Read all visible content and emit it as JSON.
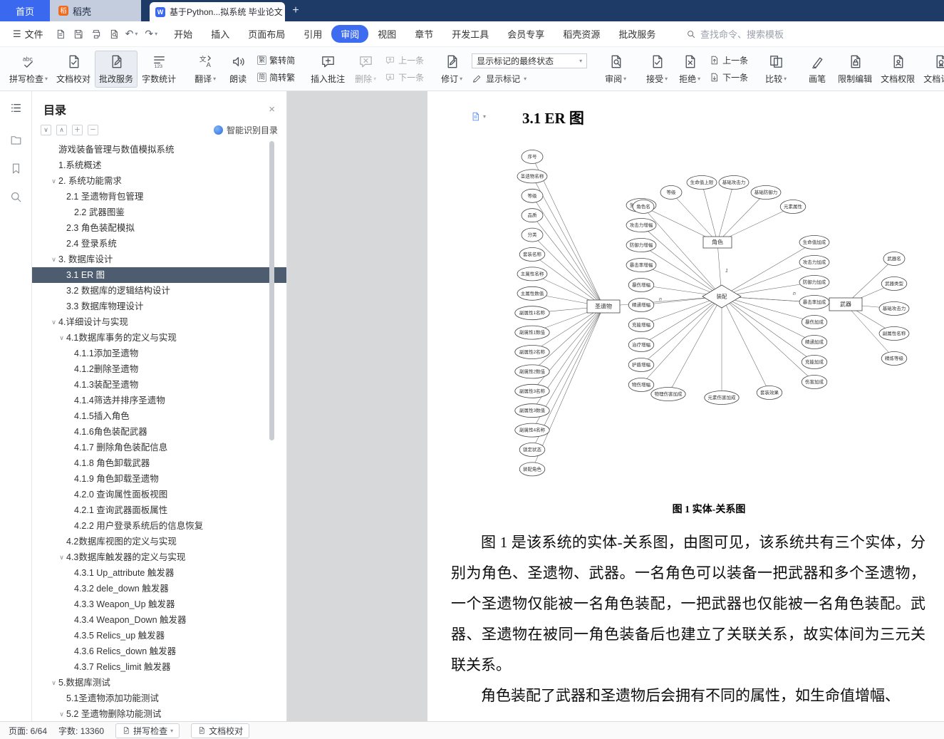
{
  "titlebar": {
    "home_tab": "首页",
    "docer_tab": "稻壳",
    "doc_tab": "基于Python...拟系统 毕业论文",
    "new_tab_label": "+"
  },
  "menubar": {
    "file_label": "文件",
    "menus": [
      "开始",
      "插入",
      "页面布局",
      "引用",
      "审阅",
      "视图",
      "章节",
      "开发工具",
      "会员专享",
      "稻壳资源",
      "批改服务"
    ],
    "active_menu": "审阅",
    "search_placeholder": "查找命令、搜索模板"
  },
  "ribbon": {
    "spell_check": "拼写检查",
    "doc_proof": "文档校对",
    "correction": "批改服务",
    "word_count": "字数统计",
    "translate": "翻译",
    "read_aloud": "朗读",
    "trad_to_simp": "繁转简",
    "simp_to_trad": "简转繁",
    "insert_comment": "插入批注",
    "delete_comment": "删除",
    "prev_comment": "上一条",
    "next_comment": "下一条",
    "revision": "修订",
    "markup_state": "显示标记的最终状态",
    "show_markup": "显示标记",
    "review": "审阅",
    "accept": "接受",
    "reject": "拒绝",
    "prev_rev": "上一条",
    "next_rev": "下一条",
    "compare": "比较",
    "pen": "画笔",
    "restrict_edit": "限制编辑",
    "doc_permission": "文档权限",
    "doc_cert": "文档认证"
  },
  "outline_panel": {
    "title": "目录",
    "smart_recognize": "智能识别目录",
    "items": [
      {
        "label": "游戏装备管理与数值模拟系统",
        "level": 0,
        "chevron": false,
        "selected": false
      },
      {
        "label": "1.系统概述",
        "level": 0,
        "chevron": false,
        "selected": false
      },
      {
        "label": "2. 系统功能需求",
        "level": 0,
        "chevron": true,
        "selected": false
      },
      {
        "label": "2.1 圣遗物背包管理",
        "level": 1,
        "chevron": false,
        "selected": false
      },
      {
        "label": "2.2 武器图鉴",
        "level": 2,
        "chevron": false,
        "selected": false
      },
      {
        "label": "2.3 角色装配模拟",
        "level": 1,
        "chevron": false,
        "selected": false
      },
      {
        "label": "2.4 登录系统",
        "level": 1,
        "chevron": false,
        "selected": false
      },
      {
        "label": "3. 数据库设计",
        "level": 0,
        "chevron": true,
        "selected": false
      },
      {
        "label": "3.1 ER 图",
        "level": 1,
        "chevron": false,
        "selected": true
      },
      {
        "label": "3.2 数据库的逻辑结构设计",
        "level": 1,
        "chevron": false,
        "selected": false
      },
      {
        "label": "3.3 数据库物理设计",
        "level": 1,
        "chevron": false,
        "selected": false
      },
      {
        "label": "4.详细设计与实现",
        "level": 0,
        "chevron": true,
        "selected": false
      },
      {
        "label": "4.1数据库事务的定义与实现",
        "level": 1,
        "chevron": true,
        "selected": false
      },
      {
        "label": "4.1.1添加圣遗物",
        "level": 2,
        "chevron": false,
        "selected": false
      },
      {
        "label": "4.1.2删除圣遗物",
        "level": 2,
        "chevron": false,
        "selected": false
      },
      {
        "label": "4.1.3装配圣遗物",
        "level": 2,
        "chevron": false,
        "selected": false
      },
      {
        "label": "4.1.4筛选并排序圣遗物",
        "level": 2,
        "chevron": false,
        "selected": false
      },
      {
        "label": "4.1.5插入角色",
        "level": 2,
        "chevron": false,
        "selected": false
      },
      {
        "label": "4.1.6角色装配武器",
        "level": 2,
        "chevron": false,
        "selected": false
      },
      {
        "label": "4.1.7 删除角色装配信息",
        "level": 2,
        "chevron": false,
        "selected": false
      },
      {
        "label": "4.1.8 角色卸载武器",
        "level": 2,
        "chevron": false,
        "selected": false
      },
      {
        "label": "4.1.9 角色卸载圣遗物",
        "level": 2,
        "chevron": false,
        "selected": false
      },
      {
        "label": "4.2.0 查询属性面板视图",
        "level": 2,
        "chevron": false,
        "selected": false
      },
      {
        "label": "4.2.1 查询武器面板属性",
        "level": 2,
        "chevron": false,
        "selected": false
      },
      {
        "label": "4.2.2 用户登录系统后的信息恢复",
        "level": 2,
        "chevron": false,
        "selected": false
      },
      {
        "label": "4.2数据库视图的定义与实现",
        "level": 1,
        "chevron": false,
        "selected": false
      },
      {
        "label": "4.3数据库触发器的定义与实现",
        "level": 1,
        "chevron": true,
        "selected": false
      },
      {
        "label": "4.3.1 Up_attribute 触发器",
        "level": 2,
        "chevron": false,
        "selected": false
      },
      {
        "label": "4.3.2 dele_down 触发器",
        "level": 2,
        "chevron": false,
        "selected": false
      },
      {
        "label": "4.3.3 Weapon_Up 触发器",
        "level": 2,
        "chevron": false,
        "selected": false
      },
      {
        "label": "4.3.4 Weapon_Down 触发器",
        "level": 2,
        "chevron": false,
        "selected": false
      },
      {
        "label": "4.3.5 Relics_up 触发器",
        "level": 2,
        "chevron": false,
        "selected": false
      },
      {
        "label": "4.3.6 Relics_down 触发器",
        "level": 2,
        "chevron": false,
        "selected": false
      },
      {
        "label": "4.3.7 Relics_limit 触发器",
        "level": 2,
        "chevron": false,
        "selected": false
      },
      {
        "label": "5.数据库测试",
        "level": 0,
        "chevron": true,
        "selected": false
      },
      {
        "label": "5.1圣遗物添加功能测试",
        "level": 1,
        "chevron": false,
        "selected": false
      },
      {
        "label": "5.2 圣遗物删除功能测试",
        "level": 1,
        "chevron": true,
        "selected": false
      }
    ]
  },
  "document": {
    "heading": "3.1 ER 图",
    "caption": "图 1 实体-关系图",
    "paragraphs": [
      "图 1 是该系统的实体-关系图，由图可见，该系统共有三个实体，分别为角色、圣遗物、武器。一名角色可以装备一把武器和多个圣遗物，一个圣遗物仅能被一名角色装配，一把武器也仅能被一名角色装配。武器、圣遗物在被同一角色装备后也建立了关联关系，故实体间为三元关联关系。",
      "角色装配了武器和圣遗物后会拥有不同的属性，如生命值增幅、"
    ],
    "diagram": {
      "entities": {
        "relic": "圣遗物",
        "character": "角色",
        "weapon": "武器"
      },
      "relationship": "装配",
      "relic_attrs": [
        "序号",
        "圣遗物名称",
        "等级",
        "品质",
        "分类",
        "套装名称",
        "主属性名称",
        "主属性数值",
        "副属性1名称",
        "副属性1数值",
        "副属性2名称",
        "副属性2数值",
        "副属性3名称",
        "副属性3数值",
        "副属性4名称",
        "锁定状态",
        "装配角色"
      ],
      "equip_attrs_left": [
        "生命值增幅",
        "攻击力增幅",
        "防御力增幅",
        "暴击率增幅",
        "暴伤增幅",
        "精通增幅",
        "充能增幅",
        "治疗增幅",
        "护盾增幅",
        "物伤增幅"
      ],
      "character_attrs": [
        "角色名",
        "等级",
        "生命值上限",
        "基础攻击力",
        "基础防御力",
        "元素属性"
      ],
      "equip_attrs_right": [
        "生命值加成",
        "攻击力加成",
        "防御力加成",
        "暴击率加成",
        "暴伤加成",
        "精通加成",
        "充能加成",
        "伤害加成"
      ],
      "weapon_attrs": [
        "武器名",
        "武器类型",
        "基础攻击力",
        "副属性名称",
        "精炼等级"
      ],
      "bottom_attrs": [
        "物理伤害加成",
        "元素伤害加成",
        "套装效果"
      ],
      "cardinalities": [
        "n",
        "1",
        "n"
      ]
    }
  },
  "statusbar": {
    "page_label": "页面: 6/64",
    "word_count_label": "字数: 13360",
    "spell_check": "拼写检查",
    "doc_proof": "文档校对"
  }
}
